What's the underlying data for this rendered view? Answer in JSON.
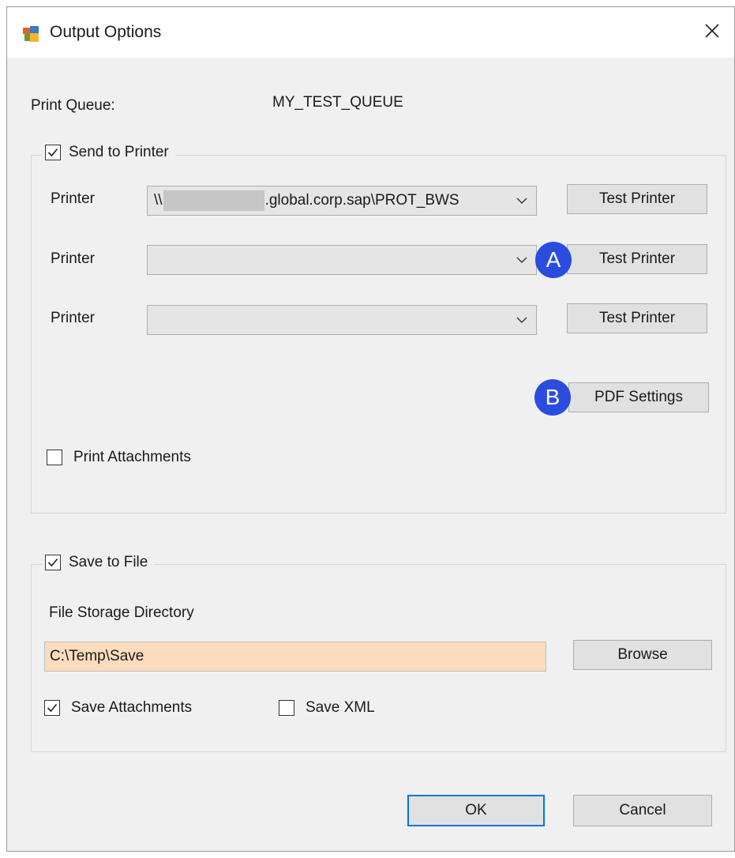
{
  "window": {
    "title": "Output Options",
    "icon": "app-window-icon",
    "close_icon": "close-icon"
  },
  "print_queue": {
    "label": "Print Queue:",
    "value": "MY_TEST_QUEUE"
  },
  "send_to_printer": {
    "label": "Send to Printer",
    "checked": true,
    "printers": [
      {
        "label": "Printer",
        "value_prefix": "\\\\",
        "value_suffix": ".global.corp.sap\\PROT_BWS",
        "button": "Test Printer"
      },
      {
        "label": "Printer",
        "value_prefix": "",
        "value_suffix": "",
        "button": "Test Printer"
      },
      {
        "label": "Printer",
        "value_prefix": "",
        "value_suffix": "",
        "button": "Test Printer"
      }
    ],
    "pdf_settings_button": "PDF Settings",
    "print_attachments": {
      "label": "Print Attachments",
      "checked": false
    }
  },
  "markers": {
    "a": "A",
    "b": "B"
  },
  "save_to_file": {
    "label": "Save to File",
    "checked": true,
    "directory_label": "File Storage Directory",
    "directory_value": "C:\\Temp\\Save",
    "browse_button": "Browse",
    "save_attachments": {
      "label": "Save Attachments",
      "checked": true
    },
    "save_xml": {
      "label": "Save XML",
      "checked": false
    }
  },
  "footer": {
    "ok_button": "OK",
    "cancel_button": "Cancel"
  },
  "colors": {
    "marker": "#2a4de0",
    "directory_field": "#fcdcbf",
    "default_button_border": "#0078d7"
  }
}
